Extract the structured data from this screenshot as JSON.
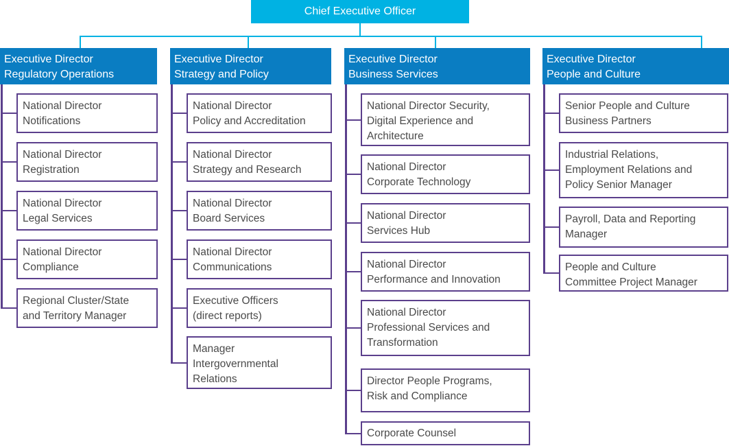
{
  "colors": {
    "ceo_fill": "#00b2e3",
    "header_fill": "#0a7dc2",
    "connector_cyan": "#00b2e3",
    "connector_purple": "#5b3f8c",
    "box_text": "#4a4a4a"
  },
  "ceo": {
    "title": "Chief Executive Officer"
  },
  "columns": [
    {
      "header": [
        "Executive Director",
        "Regulatory Operations"
      ],
      "reports": [
        [
          "National Director",
          "Notifications"
        ],
        [
          "National Director",
          "Registration"
        ],
        [
          "National Director",
          "Legal Services"
        ],
        [
          "National Director",
          "Compliance"
        ],
        [
          "Regional Cluster/State",
          "and Territory Manager"
        ]
      ]
    },
    {
      "header": [
        "Executive Director",
        "Strategy and Policy"
      ],
      "reports": [
        [
          "National Director",
          "Policy and Accreditation"
        ],
        [
          "National Director",
          "Strategy and Research"
        ],
        [
          "National Director",
          "Board Services"
        ],
        [
          "National Director",
          "Communications"
        ],
        [
          "Executive Officers",
          "(direct reports)"
        ],
        [
          "Manager",
          "Intergovernmental",
          "Relations"
        ]
      ]
    },
    {
      "header": [
        "Executive Director",
        "Business Services"
      ],
      "reports": [
        [
          "National Director Security,",
          "Digital Experience and",
          "Architecture"
        ],
        [
          "National Director",
          "Corporate Technology"
        ],
        [
          "National Director",
          "Services Hub"
        ],
        [
          "National Director",
          "Performance and Innovation"
        ],
        [
          "National Director",
          "Professional Services and",
          "Transformation"
        ],
        [
          "Director People Programs,",
          "Risk and Compliance"
        ],
        [
          "Corporate Counsel"
        ]
      ]
    },
    {
      "header": [
        "Executive Director",
        "People and Culture"
      ],
      "reports": [
        [
          "Senior People and Culture",
          "Business Partners"
        ],
        [
          "Industrial Relations,",
          "Employment Relations and",
          "Policy Senior Manager"
        ],
        [
          "Payroll, Data and Reporting",
          "Manager"
        ],
        [
          "People and Culture",
          "Committee Project Manager"
        ]
      ]
    }
  ]
}
